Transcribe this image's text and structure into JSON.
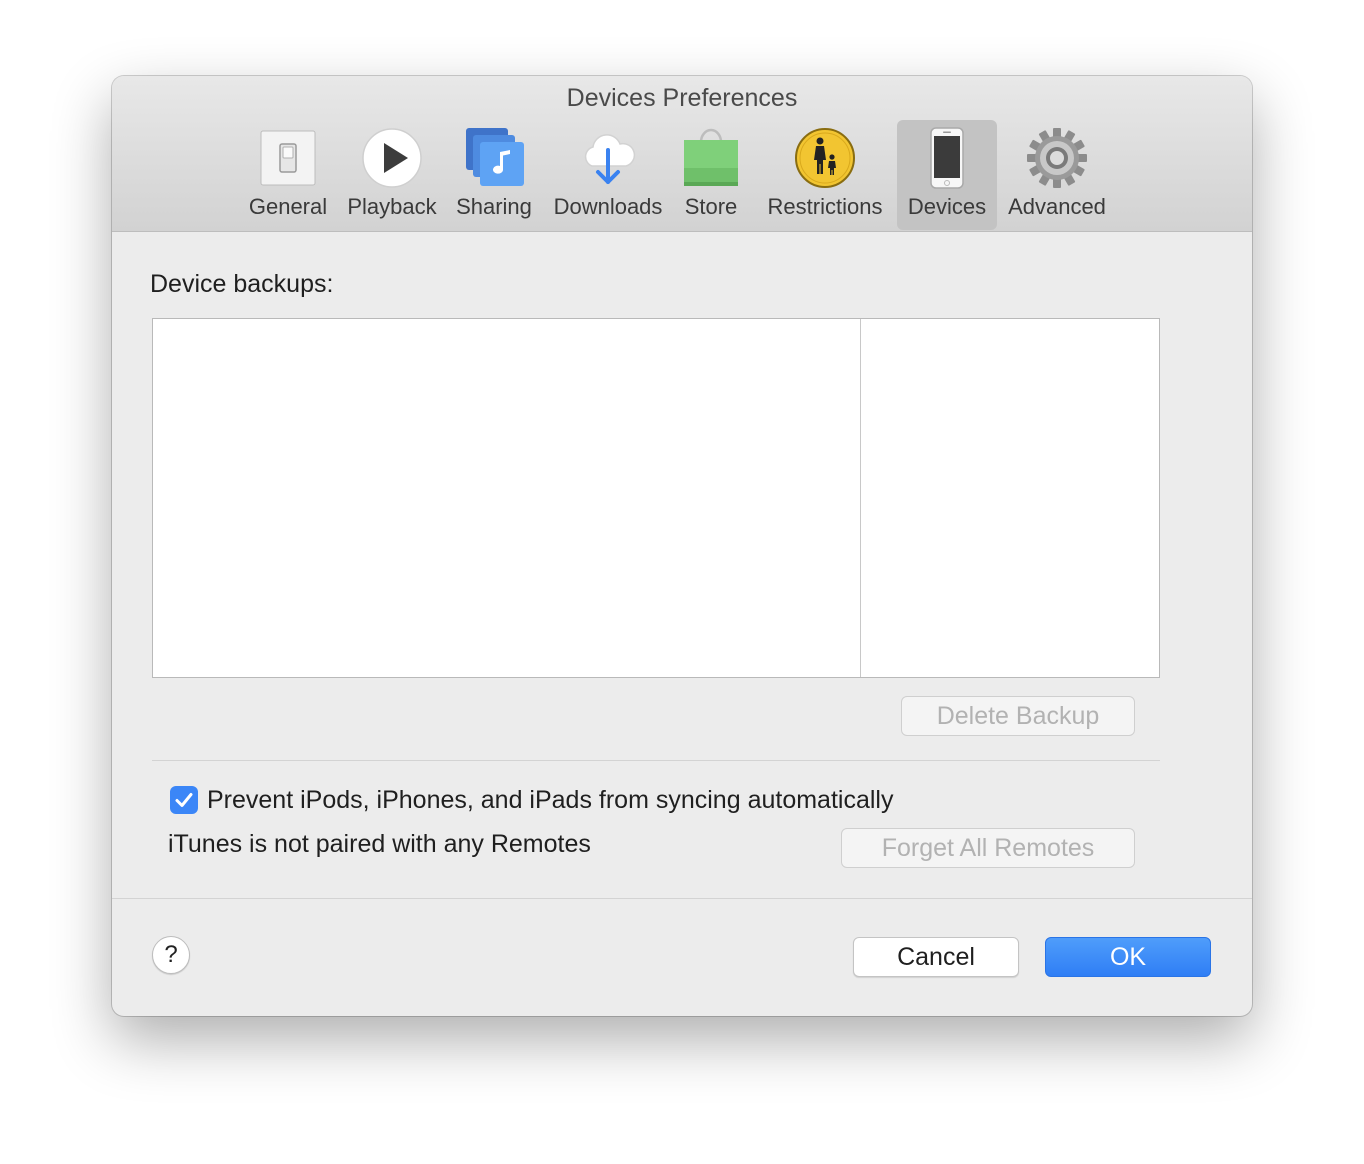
{
  "window": {
    "title": "Devices Preferences"
  },
  "toolbar": {
    "items": [
      {
        "label": "General",
        "icon": "switch-icon"
      },
      {
        "label": "Playback",
        "icon": "play-icon"
      },
      {
        "label": "Sharing",
        "icon": "music-library-icon"
      },
      {
        "label": "Downloads",
        "icon": "cloud-download-icon"
      },
      {
        "label": "Store",
        "icon": "shopping-bag-icon"
      },
      {
        "label": "Restrictions",
        "icon": "parental-controls-icon"
      },
      {
        "label": "Devices",
        "icon": "iphone-icon",
        "selected": true
      },
      {
        "label": "Advanced",
        "icon": "gear-icon"
      }
    ]
  },
  "backups": {
    "label": "Device backups:",
    "delete_button": "Delete Backup"
  },
  "sync": {
    "prevent_label": "Prevent iPods, iPhones, and iPads from syncing automatically",
    "prevent_checked": true
  },
  "remotes": {
    "status": "iTunes is not paired with any Remotes",
    "forget_button": "Forget All Remotes"
  },
  "footer": {
    "help": "?",
    "cancel": "Cancel",
    "ok": "OK"
  },
  "colors": {
    "accent": "#3b86f7",
    "selected_tab": "#c3c3c3"
  }
}
